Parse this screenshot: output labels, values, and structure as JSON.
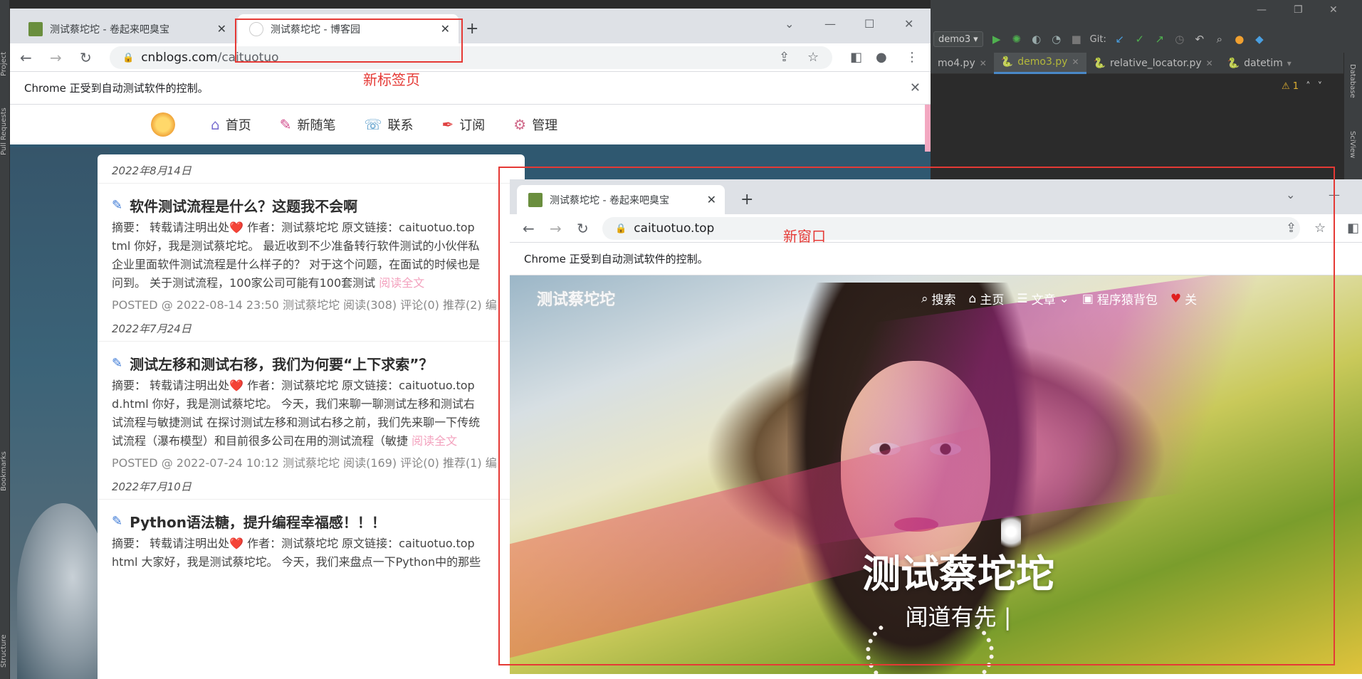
{
  "ide": {
    "left_tabs": [
      "Project",
      "Pull Requests",
      "Bookmarks",
      "Structure"
    ],
    "right_tabs": [
      "Database",
      "SciView"
    ],
    "run_config": "demo3",
    "git_label": "Git:",
    "file_tabs": [
      {
        "label": "mo4.py",
        "active": false
      },
      {
        "label": "demo3.py",
        "active": true
      },
      {
        "label": "relative_locator.py",
        "active": false
      },
      {
        "label": "datetim",
        "active": false
      }
    ],
    "warnings": "⚠ 1"
  },
  "window1": {
    "tabs": [
      {
        "label": "测试蔡坨坨 - 卷起来吧臭宝",
        "active": false
      },
      {
        "label": "测试蔡坨坨 - 博客园",
        "active": true
      }
    ],
    "url_host": "cnblogs.com",
    "url_path": "/caituotuo",
    "infobar": "Chrome 正受到自动测试软件的控制。",
    "nav": [
      {
        "label": "首页",
        "icon": "house-icon"
      },
      {
        "label": "新随笔",
        "icon": "pen-cup-icon"
      },
      {
        "label": "联系",
        "icon": "contact-icon"
      },
      {
        "label": "订阅",
        "icon": "rss-icon"
      },
      {
        "label": "管理",
        "icon": "gear-icon"
      }
    ],
    "posts": [
      {
        "date": "2022年8月14日",
        "title": "软件测试流程是什么？这题我不会啊",
        "lines": [
          "摘要：  转载请注明出处❤️ 作者：测试蔡坨坨 原文链接：caituotuo.top",
          "tml 你好，我是测试蔡坨坨。 最近收到不少准备转行软件测试的小伙伴私",
          "企业里面软件测试流程是什么样子的？ 对于这个问题，在面试的时候也是",
          "问到。 关于测试流程，100家公司可能有100套测试"
        ],
        "readmore": "阅读全文",
        "meta": "POSTED @ 2022-08-14 23:50 测试蔡坨坨 阅读(308) 评论(0) 推荐(2) 编"
      },
      {
        "date": "2022年7月24日",
        "title": "测试左移和测试右移，我们为何要“上下求索”？",
        "lines": [
          "摘要：  转载请注明出处❤️ 作者：测试蔡坨坨 原文链接：caituotuo.top",
          "d.html 你好，我是测试蔡坨坨。 今天，我们来聊一聊测试左移和测试右",
          "试流程与敏捷测试 在探讨测试左移和测试右移之前，我们先来聊一下传统",
          "试流程（瀑布模型）和目前很多公司在用的测试流程（敏捷"
        ],
        "readmore": "阅读全文",
        "meta": "POSTED @ 2022-07-24 10:12 测试蔡坨坨 阅读(169) 评论(0) 推荐(1) 编"
      },
      {
        "date": "2022年7月10日",
        "title": "Python语法糖，提升编程幸福感！！！",
        "lines": [
          "摘要：  转载请注明出处❤️ 作者：测试蔡坨坨 原文链接：caituotuo.top",
          "html 大家好，我是测试蔡坨坨。 今天，我们来盘点一下Python中的那些"
        ],
        "readmore": "",
        "meta": ""
      }
    ],
    "annotation": "新标签页"
  },
  "window2": {
    "tab_label": "测试蔡坨坨 - 卷起来吧臭宝",
    "url": "caituotuo.top",
    "infobar": "Chrome 正受到自动测试软件的控制。",
    "site_logo": "测试蔡坨坨",
    "site_nav": [
      {
        "label": "搜索",
        "icon": "search-icon"
      },
      {
        "label": "主页",
        "icon": "home-icon"
      },
      {
        "label": "文章",
        "icon": "list-icon"
      },
      {
        "label": "程序猿背包",
        "icon": "briefcase-icon"
      },
      {
        "label": "关",
        "icon": "heart-icon"
      }
    ],
    "hero_title": "测试蔡坨坨",
    "hero_subtitle": "闻道有先 |",
    "annotation": "新窗口"
  },
  "colors": {
    "annotation_red": "#e53935",
    "chrome_tabbar": "#dee1e6",
    "ide_bg": "#3c3f41"
  }
}
